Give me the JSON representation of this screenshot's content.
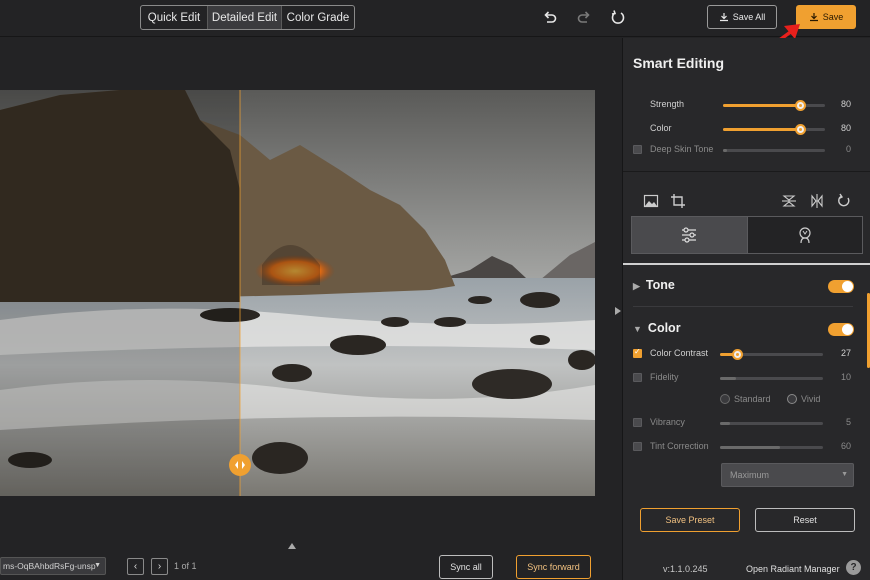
{
  "topbar": {
    "modes": [
      "Quick Edit",
      "Detailed Edit",
      "Color Grade"
    ],
    "active_mode": "Detailed Edit",
    "save_all_label": "Save All",
    "save_label": "Save",
    "icons": [
      "undo-icon",
      "redo-icon",
      "reset-icon"
    ]
  },
  "canvas": {
    "file_name": "ms-OqBAhbdRsFg-unsp",
    "page_count": "1 of 1",
    "sync_all_label": "Sync all",
    "sync_forward_label": "Sync forward"
  },
  "panel": {
    "title": "Smart Editing",
    "smart": [
      {
        "label": "Strength",
        "value": "80",
        "level": 0.8,
        "checkbox": false,
        "enabled": true
      },
      {
        "label": "Color",
        "value": "80",
        "level": 0.8,
        "checkbox": false,
        "enabled": true
      },
      {
        "label": "Deep Skin Tone",
        "value": "0",
        "level": 0,
        "checkbox": true,
        "checked": false,
        "enabled": false
      }
    ],
    "tool_icons": [
      "image-icon",
      "crop-icon",
      "flip-vertical-icon",
      "flip-horizontal-icon",
      "rotate-icon"
    ],
    "tabs": [
      "adjustments-icon",
      "portrait-icon"
    ],
    "sections": {
      "tone": {
        "label": "Tone",
        "enabled": true
      },
      "color": {
        "label": "Color",
        "enabled": true
      }
    },
    "color_rows": {
      "contrast": {
        "label": "Color Contrast",
        "value": "27",
        "level": 0.27,
        "checked": true
      },
      "fidelity": {
        "label": "Fidelity",
        "value": "10",
        "level": 0.1,
        "checked": false
      },
      "vibrancy": {
        "label": "Vibrancy",
        "value": "5",
        "level": 0.05,
        "checked": false
      },
      "tint": {
        "label": "Tint Correction",
        "value": "60",
        "level": 0.6,
        "checked": false
      }
    },
    "radio_standard": "Standard",
    "radio_vivid": "Vivid",
    "select_value": "Maximum",
    "save_preset_label": "Save Preset",
    "reset_label": "Reset",
    "version": "v:1.1.0.245",
    "open_manager_label": "Open Radiant Manager",
    "help_label": "?"
  },
  "colors": {
    "accent": "#f0a030",
    "background": "#232325",
    "panel": "#28282a"
  }
}
